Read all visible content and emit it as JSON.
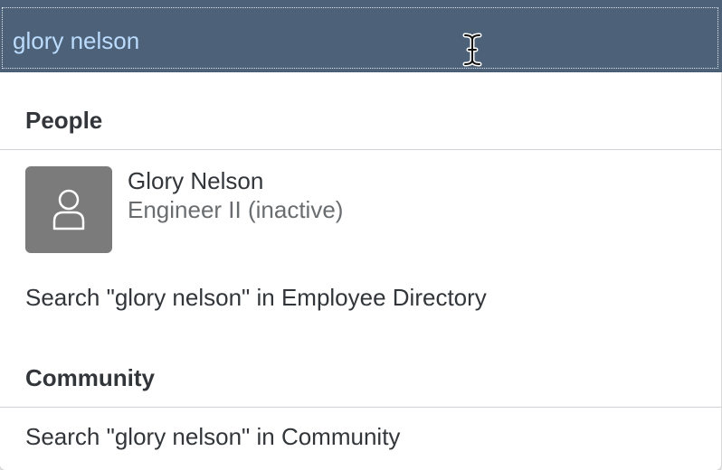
{
  "search": {
    "value": "glory nelson"
  },
  "icons": {
    "cursor": "text-cursor-icon",
    "avatar": "person-icon"
  },
  "colors": {
    "search_bar_bg": "#4d6278",
    "search_text": "#bcdcff",
    "avatar_bg": "#7b7b7b"
  },
  "suggestions": {
    "people": {
      "title": "People",
      "person": {
        "name": "Glory Nelson",
        "job_title": "Engineer II (inactive)"
      },
      "search_link": "Search \"glory nelson\" in Employee Directory"
    },
    "community": {
      "title": "Community",
      "search_link": "Search \"glory nelson\" in Community"
    }
  }
}
